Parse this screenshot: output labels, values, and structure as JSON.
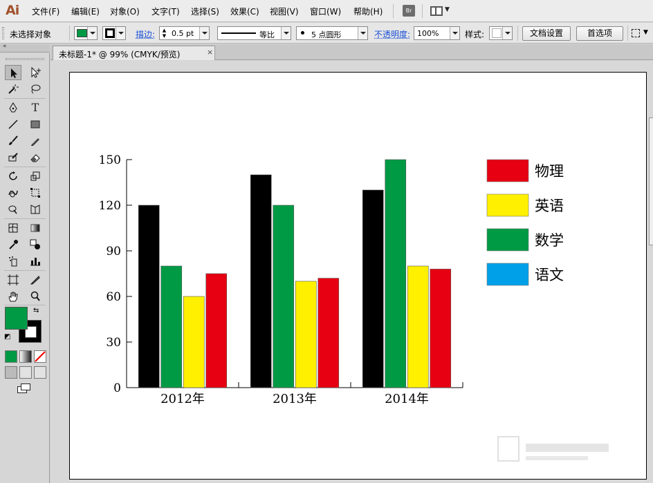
{
  "app": {
    "logo": "Ai"
  },
  "menu": [
    {
      "id": "file",
      "label": "文件(F)"
    },
    {
      "id": "edit",
      "label": "编辑(E)"
    },
    {
      "id": "object",
      "label": "对象(O)"
    },
    {
      "id": "type",
      "label": "文字(T)"
    },
    {
      "id": "select",
      "label": "选择(S)"
    },
    {
      "id": "effect",
      "label": "效果(C)"
    },
    {
      "id": "view",
      "label": "视图(V)"
    },
    {
      "id": "window",
      "label": "窗口(W)"
    },
    {
      "id": "help",
      "label": "帮助(H)"
    }
  ],
  "menu_extras": {
    "bridge_label": "Br"
  },
  "control": {
    "selection_status": "未选择对象",
    "fill_color": "#009a44",
    "stroke_label": "描边:",
    "stroke_weight": "0.5 pt",
    "stroke_profile": "等比",
    "brush": "5 点圆形",
    "opacity_label": "不透明度:",
    "opacity": "100%",
    "style_label": "样式:",
    "doc_setup": "文档设置",
    "preferences": "首选项"
  },
  "document_tab": {
    "title": "未标题-1* @ 99% (CMYK/预览)",
    "close": "×"
  },
  "tools": {
    "fill_color": "#009a44",
    "stroke_color": "#000000"
  },
  "chart_data": {
    "type": "bar",
    "categories": [
      "2012年",
      "2013年",
      "2014年"
    ],
    "series": [
      {
        "name": "",
        "color": "#000000",
        "values": [
          120,
          140,
          130
        ]
      },
      {
        "name": "数学",
        "color": "#009a44",
        "values": [
          80,
          120,
          150
        ]
      },
      {
        "name": "英语",
        "color": "#fff000",
        "values": [
          60,
          70,
          80
        ]
      },
      {
        "name": "物理",
        "color": "#e60012",
        "values": [
          75,
          72,
          78
        ]
      }
    ],
    "legend": [
      {
        "label": "物理",
        "color": "#e60012"
      },
      {
        "label": "英语",
        "color": "#fff000"
      },
      {
        "label": "数学",
        "color": "#009a44"
      },
      {
        "label": "语文",
        "color": "#00a0e9"
      }
    ],
    "yticks": [
      0,
      30,
      60,
      90,
      120,
      150
    ],
    "ylim": [
      0,
      150
    ],
    "legend_position": "right",
    "grid": false
  }
}
